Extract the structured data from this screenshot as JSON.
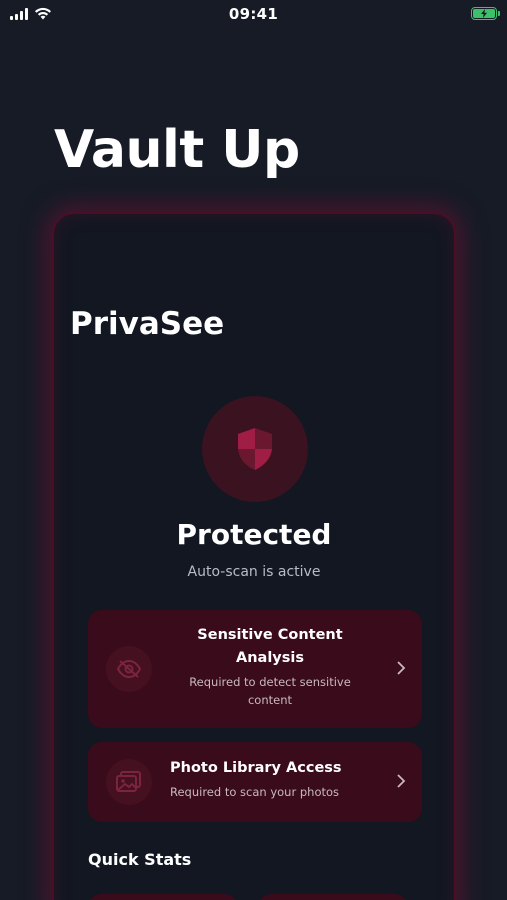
{
  "status_bar": {
    "time": "09:41",
    "battery_color": "#3ec06a"
  },
  "app_title": "Vault Up",
  "card": {
    "title": "PrivaSee",
    "accent_color": "#4a0f24",
    "shield_icon": "shield-icon",
    "status_title": "Protected",
    "status_subtitle": "Auto-scan is active",
    "permissions": [
      {
        "icon": "eye-slash-icon",
        "title": "Sensitive Content Analysis",
        "description": "Required to detect sensitive content"
      },
      {
        "icon": "photos-icon",
        "title": "Photo Library Access",
        "description": "Required to scan your photos"
      }
    ],
    "quick_stats_title": "Quick Stats"
  }
}
